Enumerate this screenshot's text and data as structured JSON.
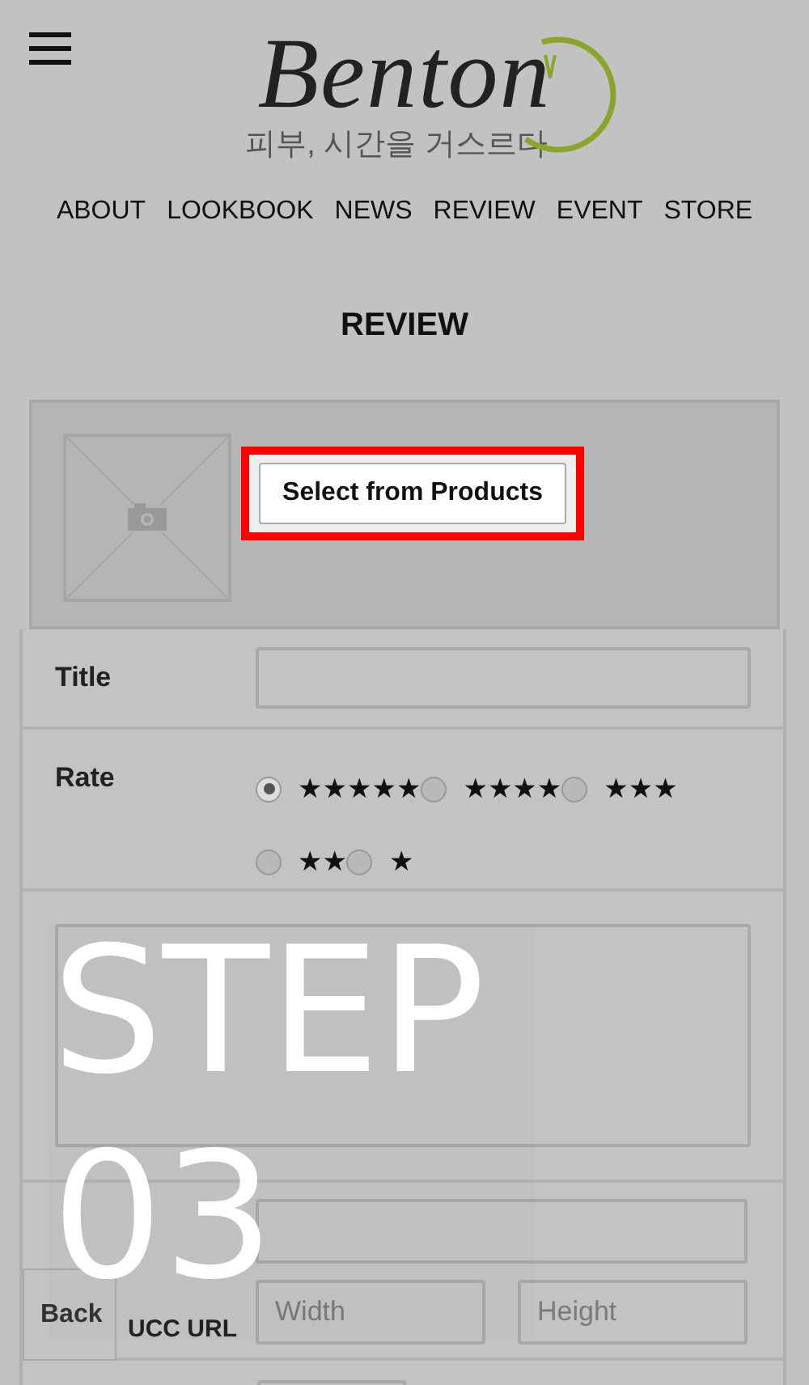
{
  "header": {
    "brand": "Benton",
    "tagline": "피부, 시간을 거스르다"
  },
  "nav": [
    {
      "label": "ABOUT"
    },
    {
      "label": "LOOKBOOK"
    },
    {
      "label": "NEWS"
    },
    {
      "label": "REVIEW"
    },
    {
      "label": "EVENT"
    },
    {
      "label": "STORE"
    }
  ],
  "page_title": "REVIEW",
  "product": {
    "button": "Select from Products",
    "highlighted": true
  },
  "form": {
    "title_label": "Title",
    "rate_label": "Rate",
    "rates": [
      {
        "label": "★★★★★",
        "selected": true
      },
      {
        "label": "★★★★",
        "selected": false
      },
      {
        "label": "★★★",
        "selected": false
      },
      {
        "label": "★★",
        "selected": false
      },
      {
        "label": "★",
        "selected": false
      }
    ],
    "ucc_label": "UCC URL",
    "width_placeholder": "Width",
    "height_placeholder": "Height",
    "back_button": "Back"
  },
  "overlay": {
    "step_word": "STEP",
    "step_number": "03"
  }
}
